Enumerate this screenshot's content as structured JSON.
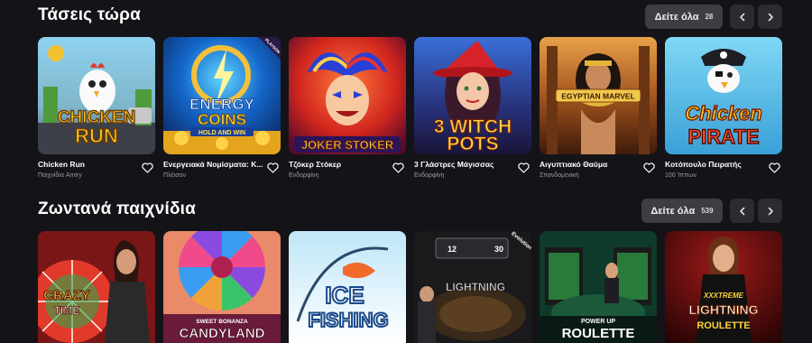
{
  "trending": {
    "title": "Τάσεις τώρα",
    "see_all_label": "Δείτε όλα",
    "see_all_count": "28",
    "games": [
      {
        "name": "Chicken Run",
        "provider": "Παιχνίδια Amiry",
        "art_line1": "CHICKEN",
        "art_line2": "RUN"
      },
      {
        "name": "Ενεργειακά Νομίσματα: Κ...",
        "provider": "Πλέισον",
        "art_line1": "ENERGY",
        "art_line2": "COINS",
        "art_line3": "HOLD AND WIN",
        "badge": "PLAYSON"
      },
      {
        "name": "Τζόκερ Στόκερ",
        "provider": "Ενδορφίνη",
        "art_line1": "JOKER STOKER"
      },
      {
        "name": "3 Γλάστρες Μάγισσας",
        "provider": "Ενδορφίνη",
        "art_line1": "3 WITCH",
        "art_line2": "POTS"
      },
      {
        "name": "Αιγυπτιακό Θαύμα",
        "provider": "Σπανδομενική",
        "art_line1": "EGYPTIAN MARVEL"
      },
      {
        "name": "Κοτόπουλο Πειρατής",
        "provider": "100 Ίππων",
        "art_line1": "Chicken",
        "art_line2": "PIRATE"
      }
    ]
  },
  "live": {
    "title": "Ζωντανά παιχνίδια",
    "see_all_label": "Δείτε όλα",
    "see_all_count": "539",
    "games": [
      {
        "art_line1": "CRAZY",
        "art_line2": "TIME"
      },
      {
        "art_line1": "SWEET BONANZA",
        "art_line2": "CANDYLAND"
      },
      {
        "art_line1": "ICE",
        "art_line2": "FISHING"
      },
      {
        "art_line1": "LIGHTNING",
        "art_numbers": [
          "12",
          "30"
        ],
        "badge": "Evolution"
      },
      {
        "art_line1": "POWER UP",
        "art_line2": "ROULETTE"
      },
      {
        "art_line1": "XXXTREME",
        "art_line2": "LIGHTNING",
        "art_line3": "ROULETTE"
      }
    ]
  },
  "colors": {
    "background": "#141418",
    "button": "#3d3d44",
    "nav_button": "#2b2b31",
    "muted_text": "#9a9aa2"
  },
  "icons": {
    "prev": "chevron-left-icon",
    "next": "chevron-right-icon",
    "favorite": "heart-outline-icon"
  }
}
